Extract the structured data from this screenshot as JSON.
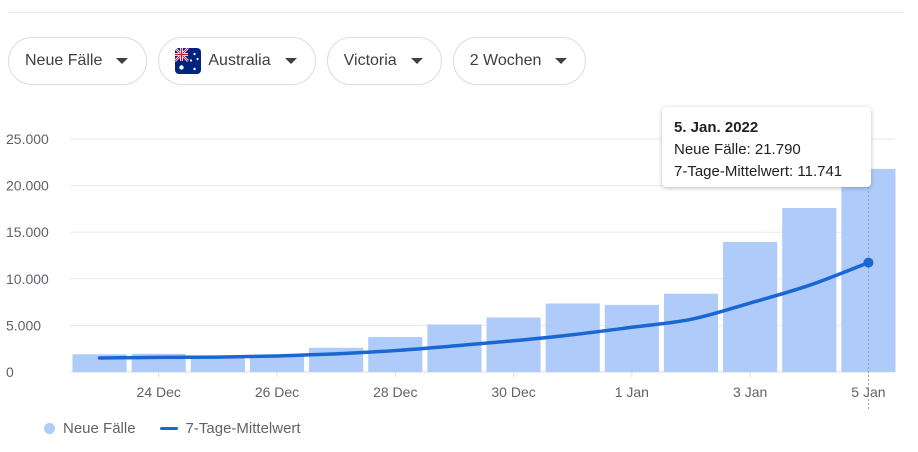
{
  "filters": {
    "metric": "Neue Fälle",
    "country": "Australia",
    "region": "Victoria",
    "period": "2 Wochen"
  },
  "colors": {
    "bar": "#aecbfa",
    "line": "#1967d2",
    "grid": "#e8eaed",
    "axis": "#dadce0",
    "text": "#5f6368"
  },
  "chart_data": {
    "type": "bar",
    "series": [
      {
        "name": "Neue Fälle",
        "type": "bar",
        "values": [
          1900,
          1950,
          1500,
          1750,
          2600,
          3750,
          5100,
          5850,
          7350,
          7200,
          8400,
          13950,
          17600,
          21790
        ]
      },
      {
        "name": "7-Tage-Mittelwert",
        "type": "line",
        "values": [
          1500,
          1570,
          1600,
          1720,
          1950,
          2300,
          2800,
          3350,
          4000,
          4800,
          5650,
          7400,
          9300,
          11741
        ]
      }
    ],
    "x_ticks": [
      {
        "index": 1,
        "label": "24 Dec"
      },
      {
        "index": 3,
        "label": "26 Dec"
      },
      {
        "index": 5,
        "label": "28 Dec"
      },
      {
        "index": 7,
        "label": "30 Dec"
      },
      {
        "index": 9,
        "label": "1 Jan"
      },
      {
        "index": 11,
        "label": "3 Jan"
      },
      {
        "index": 13,
        "label": "5 Jan"
      }
    ],
    "y_ticks": [
      {
        "value": 0,
        "label": "0"
      },
      {
        "value": 5000,
        "label": "5.000"
      },
      {
        "value": 10000,
        "label": "10.000"
      },
      {
        "value": 15000,
        "label": "15.000"
      },
      {
        "value": 20000,
        "label": "20.000"
      },
      {
        "value": 25000,
        "label": "25.000"
      }
    ],
    "ylim": [
      0,
      25000
    ],
    "grid": true,
    "legend": "bottom-left",
    "highlight_index": 13
  },
  "tooltip": {
    "title": "5. Jan. 2022",
    "cases_line": "Neue Fälle: 21.790",
    "avg_line": "7-Tage-Mittelwert: 11.741"
  },
  "legend": {
    "cases": "Neue Fälle",
    "avg": "7-Tage-Mittelwert"
  }
}
